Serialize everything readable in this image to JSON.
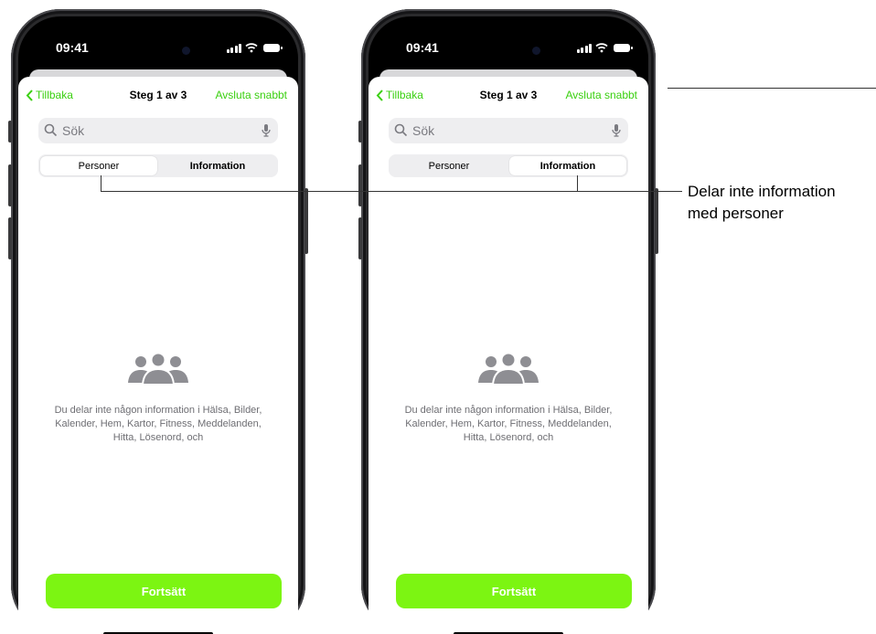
{
  "phones": [
    {
      "status": {
        "time": "09:41"
      },
      "nav": {
        "back": "Tillbaka",
        "step": "Steg 1 av 3",
        "done": "Avsluta snabbt"
      },
      "search": {
        "placeholder": "Sök"
      },
      "segments": {
        "left": "Personer",
        "right": "Information",
        "active": "Personer"
      },
      "empty_message": "Du delar inte någon information i Hälsa, Bilder, Kalender, Hem, Kartor, Fitness, Meddelanden, Hitta, Lösenord, och",
      "primary_button": "Fortsätt"
    },
    {
      "status": {
        "time": "09:41"
      },
      "nav": {
        "back": "Tillbaka",
        "step": "Steg 1 av 3",
        "done": "Avsluta snabbt"
      },
      "search": {
        "placeholder": "Sök"
      },
      "segments": {
        "left": "Personer",
        "right": "Information",
        "active": "Information"
      },
      "empty_message": "Du delar inte någon information i Hälsa, Bilder, Kalender, Hem, Kartor, Fitness, Meddelanden, Hitta, Lösenord, och",
      "primary_button": "Fortsätt"
    }
  ],
  "callout": {
    "line1": "Delar inte information",
    "line2": "med personer"
  },
  "colors": {
    "accent": "#7cf512",
    "link": "#3ad010",
    "icon_gray": "#8e8e93"
  },
  "icons": [
    "back-chevron-icon",
    "search-icon",
    "microphone-icon",
    "people-group-icon",
    "signal-icon",
    "wifi-icon",
    "battery-icon"
  ]
}
